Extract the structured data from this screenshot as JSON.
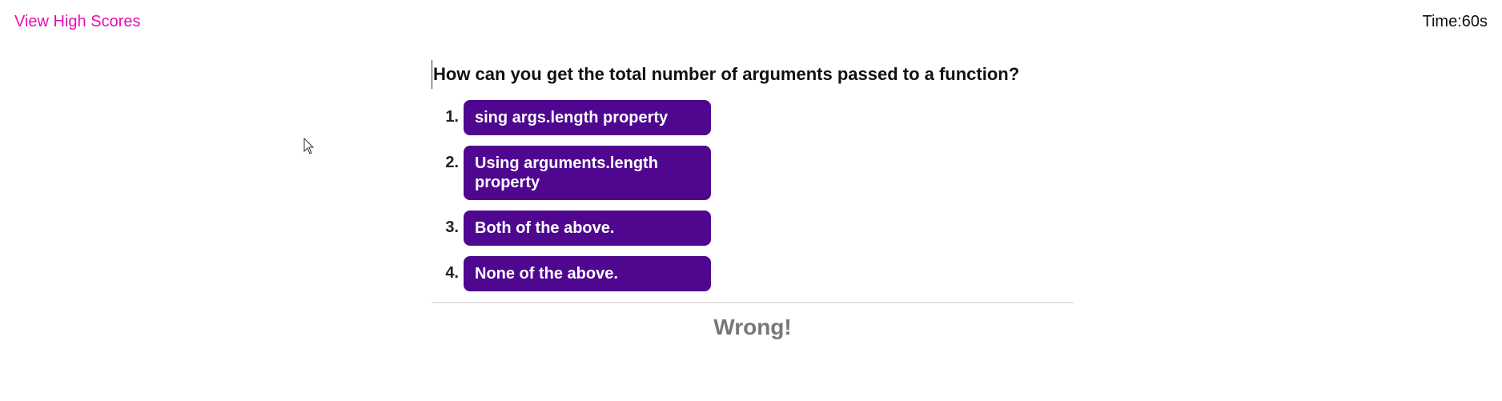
{
  "header": {
    "high_scores_label": "View High Scores",
    "timer_label": "Time:",
    "timer_value": "60s"
  },
  "quiz": {
    "question": "How can you get the total number of arguments passed to a function?",
    "choices": [
      {
        "number": "1.",
        "label": "sing args.length property"
      },
      {
        "number": "2.",
        "label": "Using arguments.length property"
      },
      {
        "number": "3.",
        "label": "Both of the above."
      },
      {
        "number": "4.",
        "label": "None of the above."
      }
    ],
    "feedback": "Wrong!"
  },
  "colors": {
    "link": "#e40fb1",
    "button": "#4f0790",
    "button_text": "#ffffff",
    "feedback": "#777777"
  },
  "icons": {
    "cursor": "mouse-pointer-icon"
  }
}
